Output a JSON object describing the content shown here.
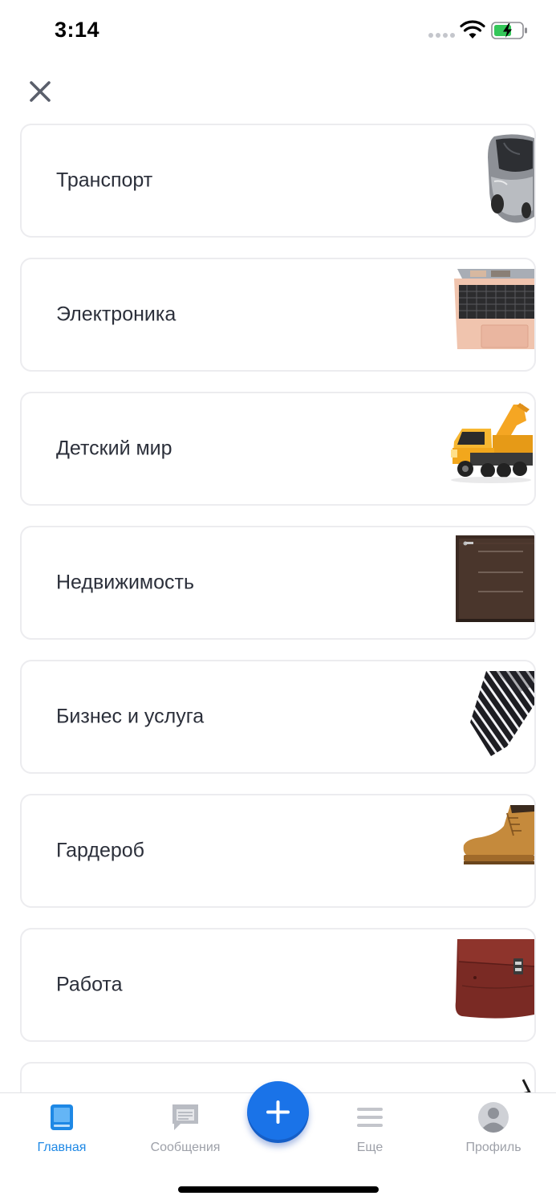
{
  "status_bar": {
    "time": "3:14"
  },
  "categories": [
    {
      "label": "Транспорт",
      "icon": "car-image"
    },
    {
      "label": "Электроника",
      "icon": "laptop-image"
    },
    {
      "label": "Детский мир",
      "icon": "toy-truck-image"
    },
    {
      "label": "Недвижимость",
      "icon": "door-image"
    },
    {
      "label": "Бизнес и услуга",
      "icon": "necktie-image"
    },
    {
      "label": "Гардероб",
      "icon": "boot-image"
    },
    {
      "label": "Работа",
      "icon": "briefcase-image"
    }
  ],
  "tab_bar": {
    "items": [
      {
        "label": "Главная",
        "icon": "home-icon",
        "active": true
      },
      {
        "label": "Сообщения",
        "icon": "messages-icon",
        "active": false
      },
      {
        "label": "Еще",
        "icon": "menu-icon",
        "active": false
      },
      {
        "label": "Профиль",
        "icon": "profile-icon",
        "active": false
      }
    ],
    "add_icon": "plus-icon"
  },
  "colors": {
    "accent": "#1a73e8",
    "active_tab": "#1e88e5",
    "inactive_tab": "#9ea1a9",
    "text": "#2b2f3a",
    "card_border": "#ececef"
  }
}
